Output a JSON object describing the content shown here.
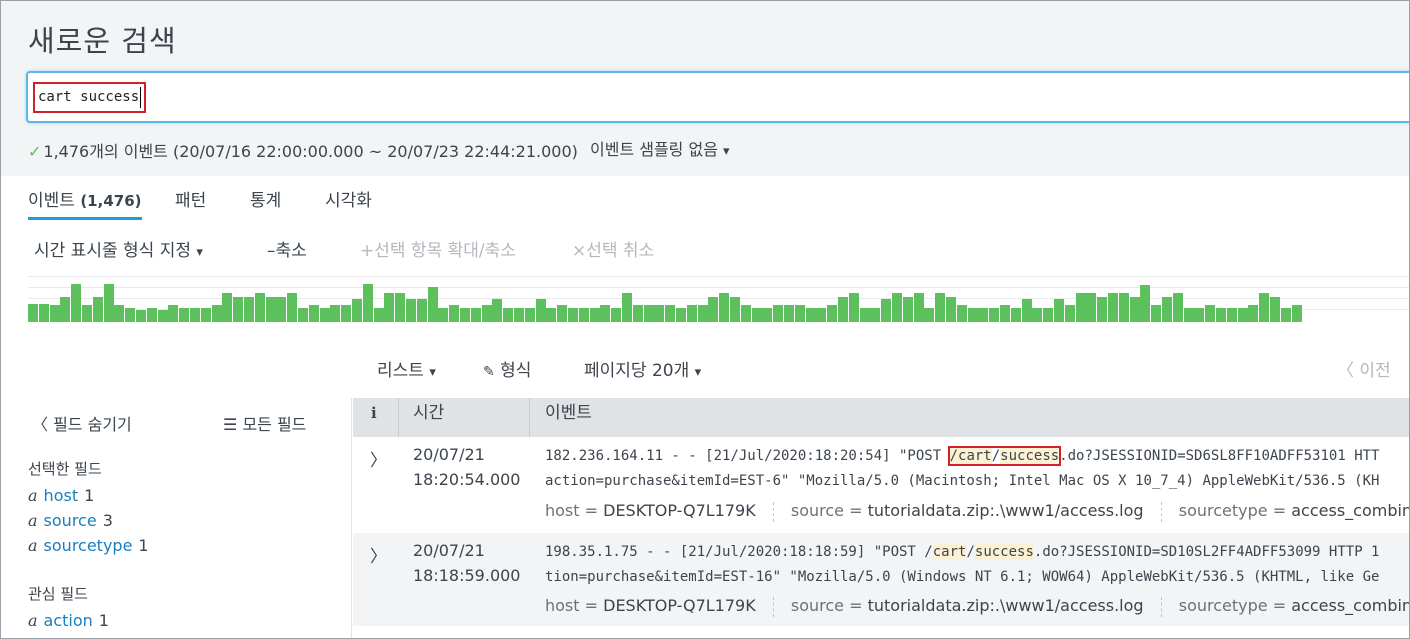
{
  "page": {
    "title": "새로운 검색"
  },
  "search": {
    "query": "cart success"
  },
  "summary": {
    "check_icon": "✓",
    "result_text": "1,476개의 이벤트 (20/07/16 22:00:00.000 ~ 20/07/23 22:44:21.000)",
    "sampling_label": "이벤트 샘플링 없음",
    "sampling_caret": "▾"
  },
  "tabs": [
    {
      "label": "이벤트",
      "count": "(1,476)"
    },
    {
      "label": "패턴"
    },
    {
      "label": "통계"
    },
    {
      "label": "시각화"
    }
  ],
  "timeline_toolbar": {
    "format_label": "시간 표시줄 형식 지정",
    "format_caret": "▾",
    "zoom_out_icon": "–",
    "zoom_out_label": "축소",
    "zoom_selection_icon": "+",
    "zoom_selection_label": "선택 항목 확대/축소",
    "deselect_icon": "×",
    "deselect_label": "선택 취소"
  },
  "timeline": {
    "color": "#5cc05c",
    "bars": [
      0.4,
      0.4,
      0.38,
      0.55,
      0.82,
      0.38,
      0.55,
      0.82,
      0.38,
      0.3,
      0.25,
      0.3,
      0.25,
      0.38,
      0.3,
      0.3,
      0.3,
      0.38,
      0.62,
      0.55,
      0.55,
      0.62,
      0.55,
      0.55,
      0.62,
      0.3,
      0.38,
      0.3,
      0.38,
      0.38,
      0.5,
      0.82,
      0.3,
      0.62,
      0.62,
      0.5,
      0.5,
      0.75,
      0.3,
      0.38,
      0.3,
      0.3,
      0.38,
      0.5,
      0.3,
      0.3,
      0.3,
      0.5,
      0.3,
      0.38,
      0.3,
      0.3,
      0.3,
      0.38,
      0.3,
      0.62,
      0.38,
      0.38,
      0.38,
      0.38,
      0.3,
      0.38,
      0.38,
      0.55,
      0.62,
      0.55,
      0.38,
      0.3,
      0.3,
      0.38,
      0.38,
      0.38,
      0.3,
      0.3,
      0.38,
      0.55,
      0.62,
      0.3,
      0.3,
      0.5,
      0.62,
      0.55,
      0.62,
      0.3,
      0.62,
      0.55,
      0.38,
      0.3,
      0.3,
      0.3,
      0.38,
      0.3,
      0.5,
      0.3,
      0.3,
      0.5,
      0.38,
      0.62,
      0.62,
      0.55,
      0.62,
      0.62,
      0.55,
      0.8,
      0.38,
      0.55,
      0.62,
      0.3,
      0.3,
      0.38,
      0.3,
      0.3,
      0.3,
      0.38,
      0.62,
      0.55,
      0.3,
      0.38,
      0.3,
      0.3,
      0.38,
      0.3,
      0.3,
      0.3,
      0.38,
      0.3,
      0.3,
      0.3,
      0.38,
      0.3,
      0.3,
      0.5,
      0.3,
      0.3,
      0.38,
      0.55,
      0.3,
      0.38,
      0.38,
      0.62,
      0.3,
      0.3,
      0.38,
      0.3,
      0.3,
      0.3,
      0.3,
      0.38,
      0.3,
      0.3,
      0.3,
      0.3,
      0.55,
      0.62,
      0.55,
      0.62,
      0.82,
      0.55,
      0.62,
      0.38,
      0.62,
      0.55,
      0.38,
      0.5,
      0.62,
      0.38,
      0.62,
      0.3,
      0.3,
      0.38,
      0.3,
      0.38,
      0.3,
      0.38,
      0.3,
      0.38,
      0.5,
      0.38,
      0.5,
      0.38,
      0.3,
      0.38,
      0.3,
      0.38,
      0.38,
      0.55,
      0.62,
      0.55,
      0.62,
      0.55,
      0.82,
      0.38,
      0.62,
      0.62,
      0.38,
      0.55,
      0.62,
      0.82,
      0.62,
      0.55,
      0.5,
      0.38,
      0.62,
      0.55,
      0.62,
      0.38,
      0.75,
      0.62,
      0.55,
      0.3,
      0.38,
      0.38,
      0.3,
      0.3,
      0.38,
      0.38,
      0.5,
      0.38,
      0.38,
      0.55,
      0.38,
      0.38,
      0.38,
      0.55,
      0.38,
      0.5,
      0.38,
      0.38,
      0.5,
      0.55,
      0.38,
      0.5,
      0.3,
      0.38
    ]
  },
  "list_controls": {
    "list_label": "리스트",
    "list_caret": "▾",
    "format_icon": "✎",
    "format_label": "형식",
    "per_page_label": "페이지당 20개",
    "per_page_caret": "▾",
    "prev_label": "〈 이전"
  },
  "sidebar": {
    "hide_fields_label": "〈 필드 숨기기",
    "all_fields_icon": "☰",
    "all_fields_label": "모든 필드",
    "selected_heading": "선택한 필드",
    "selected_fields": [
      {
        "type": "a",
        "name": "host",
        "count": "1"
      },
      {
        "type": "a",
        "name": "source",
        "count": "3"
      },
      {
        "type": "a",
        "name": "sourcetype",
        "count": "1"
      }
    ],
    "interesting_heading": "관심 필드",
    "interesting_fields": [
      {
        "type": "a",
        "name": "action",
        "count": "1"
      }
    ]
  },
  "table": {
    "col_info": "i",
    "col_time": "시간",
    "col_event": "이벤트"
  },
  "events": [
    {
      "date": "20/07/21",
      "time": "18:20:54.000",
      "line1_pre": "182.236.164.11 - - [21/Jul/2020:18:20:54] \"POST ",
      "hl_slash1": "/",
      "hl_cart": "cart",
      "hl_slash2": "/",
      "hl_success": "success",
      "line1_post": ".do?JSESSIONID=SD6SL8FF10ADFF53101 HTT",
      "line2": "action=purchase&itemId=EST-6\" \"Mozilla/5.0 (Macintosh; Intel Mac OS X 10_7_4) AppleWebKit/536.5 (KH",
      "host_key": "host =",
      "host_val": "DESKTOP-Q7L179K",
      "source_key": "source =",
      "source_val": "tutorialdata.zip:.\\www1/access.log",
      "sourcetype_key": "sourcetype =",
      "sourcetype_val": "access_combined_wc"
    },
    {
      "date": "20/07/21",
      "time": "18:18:59.000",
      "line1_pre": "198.35.1.75 - - [21/Jul/2020:18:18:59] \"POST /",
      "hl_cart": "cart",
      "hl_slash2": "/",
      "hl_success": "success",
      "line1_post": ".do?JSESSIONID=SD10SL2FF4ADFF53099 HTTP 1",
      "line2": "tion=purchase&itemId=EST-16\" \"Mozilla/5.0 (Windows NT 6.1; WOW64) AppleWebKit/536.5 (KHTML, like Ge",
      "host_key": "host =",
      "host_val": "DESKTOP-Q7L179K",
      "source_key": "source =",
      "source_val": "tutorialdata.zip:.\\www1/access.log",
      "sourcetype_key": "sourcetype =",
      "sourcetype_val": "access_combined_wc"
    }
  ]
}
